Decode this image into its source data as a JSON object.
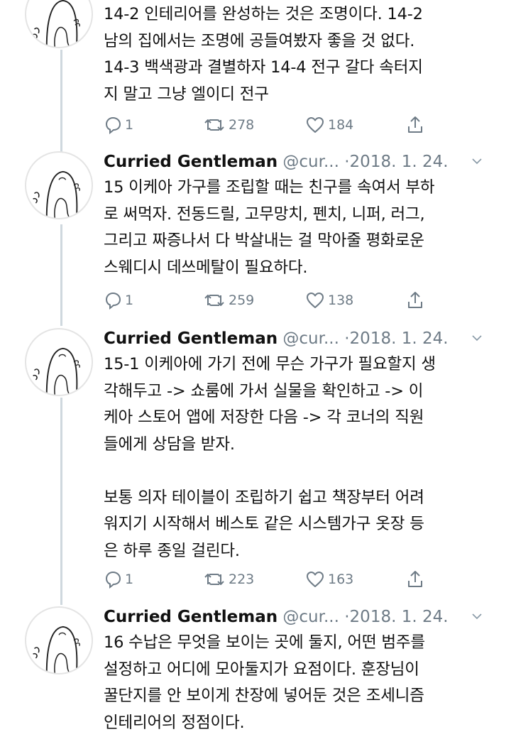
{
  "tweets": [
    {
      "name": "",
      "handle": "",
      "date": "",
      "lines": [
        "14-2 인테리어를 완성하는 것은 조명이다. 14-2",
        "남의 집에서는 조명에 공들여봤자 좋을 것 없다.",
        "14-3 백색광과 결별하자 14-4 전구 갈다 속터지",
        "지 말고 그냥 엘이디 전구"
      ],
      "replies": "1",
      "retweets": "278",
      "likes": "184"
    },
    {
      "name": "Curried Gentleman",
      "handle": "@cur...",
      "date": "2018. 1. 24.",
      "lines": [
        "15 이케아 가구를 조립할 때는 친구를 속여서 부하",
        "로 써먹자. 전동드릴, 고무망치, 펜치, 니퍼, 러그,",
        "그리고 짜증나서 다 박살내는 걸 막아줄 평화로운",
        "스웨디시 데쓰메탈이 필요하다."
      ],
      "replies": "1",
      "retweets": "259",
      "likes": "138"
    },
    {
      "name": "Curried Gentleman",
      "handle": "@cur...",
      "date": "2018. 1. 24.",
      "lines": [
        "15-1 이케아에 가기 전에 무슨 가구가 필요할지 생",
        "각해두고 -> 쇼룸에 가서 실물을 확인하고 -> 이",
        "케아 스토어 앱에 저장한 다음 -> 각 코너의 직원",
        "들에게 상담을 받자.",
        "",
        "보통 의자 테이블이 조립하기 쉽고 책장부터 어려",
        "워지기 시작해서 베스토 같은 시스템가구 옷장 등",
        "은 하루 종일 걸린다."
      ],
      "replies": "1",
      "retweets": "223",
      "likes": "163"
    },
    {
      "name": "Curried Gentleman",
      "handle": "@cur...",
      "date": "2018. 1. 24.",
      "lines": [
        "16 수납은 무엇을 보이는 곳에 둘지, 어떤 범주를",
        "설정하고 어디에 모아둘지가 요점이다. 훈장님이",
        "꿀단지를 안 보이게 찬장에 넣어둔 것은 조세니즘",
        "인테리어의 정점이다."
      ],
      "replies": "",
      "retweets": "",
      "likes": ""
    }
  ],
  "icons": {
    "reply": "reply-icon",
    "retweet": "retweet-icon",
    "like": "heart-icon",
    "share": "share-icon",
    "more": "chevron-down-icon",
    "avatar": "ghost-avatar"
  },
  "colors": {
    "text": "#111111",
    "muted": "#6e7b86",
    "thread_line": "#cfd8de",
    "background": "#ffffff"
  }
}
